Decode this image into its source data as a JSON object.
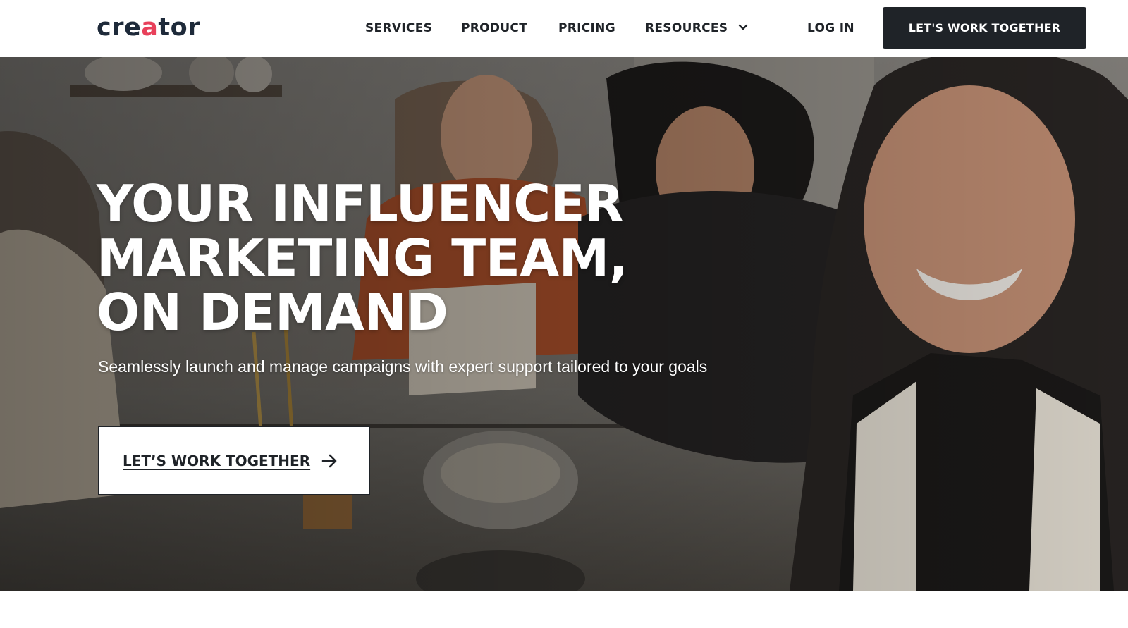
{
  "header": {
    "logo_text": "creator",
    "nav": [
      {
        "label": "SERVICES"
      },
      {
        "label": "PRODUCT"
      },
      {
        "label": "PRICING"
      },
      {
        "label": "RESOURCES",
        "icon": "chevron-down-icon"
      }
    ],
    "login_label": "LOG IN",
    "cta_label": "LET'S WORK TOGETHER"
  },
  "hero": {
    "title_lines": [
      "YOUR INFLUENCER",
      "MARKETING TEAM,",
      "ON DEMAND"
    ],
    "subtitle": "Seamlessly launch and manage campaigns with expert support tailored to your goals",
    "cta_label": "LET’S WORK TOGETHER",
    "cta_icon": "arrow-right-icon"
  },
  "colors": {
    "brand_dark": "#1f2328",
    "logo_accent": "#e8405a",
    "white": "#ffffff"
  }
}
